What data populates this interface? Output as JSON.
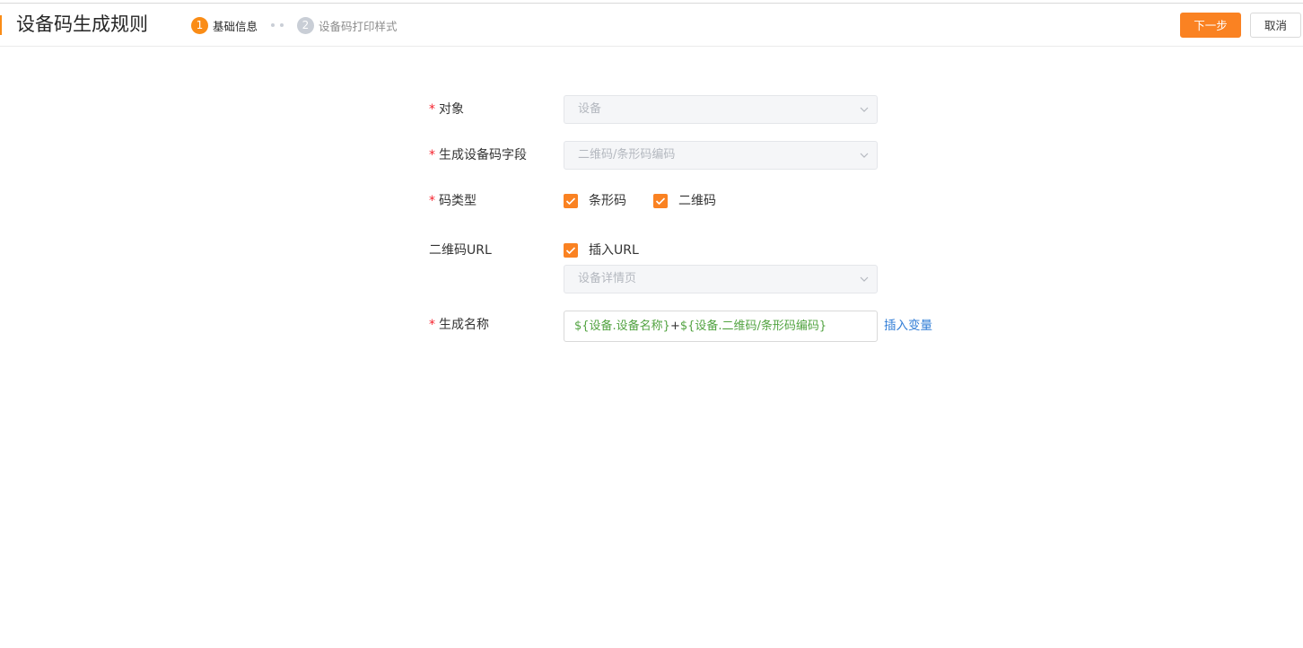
{
  "header": {
    "title": "设备码生成规则",
    "steps": [
      {
        "number": "1",
        "label": "基础信息",
        "state": "active"
      },
      {
        "number": "2",
        "label": "设备码打印样式",
        "state": "inactive"
      }
    ],
    "next_label": "下一步",
    "cancel_label": "取消"
  },
  "form": {
    "object": {
      "label": "对象",
      "required": true,
      "value": "设备"
    },
    "code_field": {
      "label": "生成设备码字段",
      "required": true,
      "value": "二维码/条形码编码"
    },
    "code_type": {
      "label": "码类型",
      "required": true,
      "options": [
        {
          "label": "条形码",
          "checked": true
        },
        {
          "label": "二维码",
          "checked": true
        }
      ]
    },
    "qr_url": {
      "label": "二维码URL",
      "required": false,
      "insert_url": {
        "label": "插入URL",
        "checked": true
      },
      "page_value": "设备详情页"
    },
    "gen_name": {
      "label": "生成名称",
      "required": true,
      "var1": "${设备.设备名称}",
      "op": "+",
      "var2": "${设备.二维码/条形码编码}",
      "insert_var_label": "插入变量"
    }
  },
  "colors": {
    "accent": "#fa8222",
    "required": "#f5222d",
    "variable": "#52a341",
    "link": "#2f7cd6"
  },
  "icons": [
    "chevron-down-icon",
    "check-icon"
  ]
}
